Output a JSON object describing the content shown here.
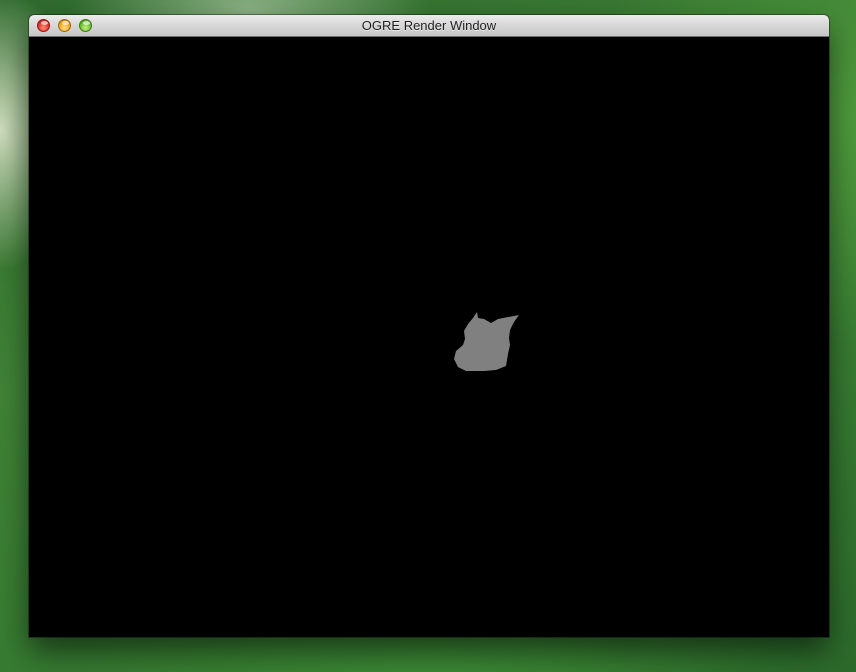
{
  "window": {
    "title": "OGRE Render Window"
  },
  "controls": {
    "close": "close-icon",
    "minimize": "minimize-icon",
    "zoom": "zoom-icon"
  },
  "colors": {
    "viewport_background": "#000000",
    "model_fill": "#808080"
  }
}
